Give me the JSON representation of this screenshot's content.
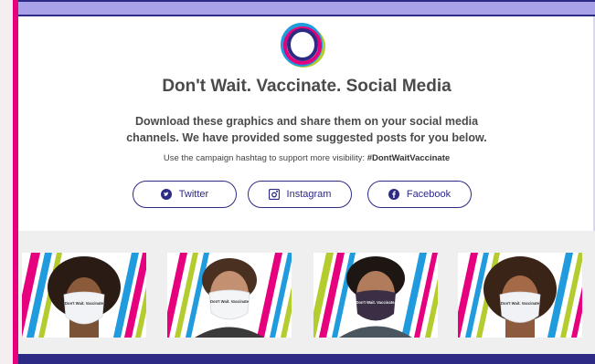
{
  "page": {
    "title": "Don't Wait. Vaccinate. Social Media",
    "description": "Download these graphics and share them on your social media channels. We have provided some suggested posts for you below.",
    "hashtag_prefix": "Use the campaign hashtag to support more visibility: ",
    "hashtag": "#DontWaitVaccinate"
  },
  "buttons": {
    "twitter": "Twitter",
    "instagram": "Instagram",
    "facebook": "Facebook"
  },
  "gallery": {
    "mask_text": [
      "Don't Wait. Vaccinate",
      "Don't Wait. Vaccinate",
      "Don't Wait. Vaccinate.",
      "Don't Wait. Vaccinate"
    ]
  },
  "colors": {
    "brand_navy": "#2d2a86",
    "accent_pink": "#e6007e",
    "lilac": "#a9a2e8",
    "lime": "#b5cc2e",
    "blue": "#1f9bde"
  },
  "icons": [
    "twitter-icon",
    "instagram-icon",
    "facebook-icon",
    "logo-rings"
  ]
}
